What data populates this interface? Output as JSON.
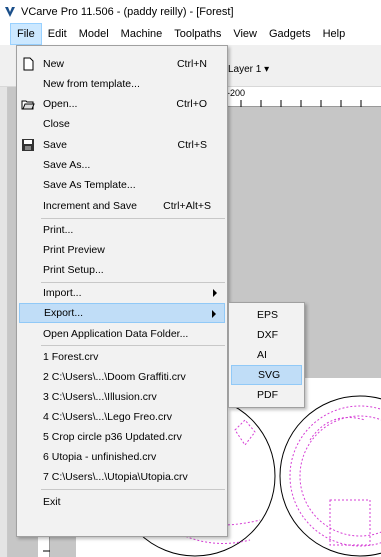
{
  "window": {
    "title": "VCarve Pro 11.506 - (paddy reilly) - [Forest]",
    "accent": "#3c7fb1",
    "highlight": "#c0ddf7"
  },
  "menubar": [
    {
      "label": "File",
      "active": true
    },
    {
      "label": "Edit"
    },
    {
      "label": "Model"
    },
    {
      "label": "Machine"
    },
    {
      "label": "Toolpaths"
    },
    {
      "label": "View"
    },
    {
      "label": "Gadgets"
    },
    {
      "label": "Help"
    }
  ],
  "toolbar": {
    "layer_label": "Layer 1 ▾"
  },
  "ruler": {
    "top_label": "-200"
  },
  "file_menu": {
    "items": [
      {
        "label": "New",
        "shortcut": "Ctrl+N",
        "icon": "new-document-icon"
      },
      {
        "label": "New from template..."
      },
      {
        "label": "Open...",
        "shortcut": "Ctrl+O",
        "icon": "open-folder-icon"
      },
      {
        "label": "Close"
      },
      {
        "label": "Save",
        "shortcut": "Ctrl+S",
        "icon": "floppy-disk-icon"
      },
      {
        "label": "Save As..."
      },
      {
        "label": "Save As Template..."
      },
      {
        "label": "Increment and Save",
        "shortcut": "Ctrl+Alt+S"
      },
      {
        "label": "Print..."
      },
      {
        "label": "Print Preview"
      },
      {
        "label": "Print Setup..."
      },
      {
        "label": "Import..."
      },
      {
        "label": "Export...",
        "highlighted": true
      },
      {
        "label": "Open Application Data Folder..."
      },
      {
        "label": "1 Forest.crv"
      },
      {
        "label": "2 C:\\Users\\...\\Doom Graffiti.crv"
      },
      {
        "label": "3 C:\\Users\\...\\Illusion.crv"
      },
      {
        "label": "4 C:\\Users\\...\\Lego Freo.crv"
      },
      {
        "label": "5 Crop circle p36 Updated.crv"
      },
      {
        "label": "6 Utopia - unfinished.crv"
      },
      {
        "label": "7 C:\\Users\\...\\Utopia\\Utopia.crv"
      },
      {
        "label": "Exit"
      }
    ]
  },
  "export_submenu": {
    "items": [
      {
        "label": "EPS"
      },
      {
        "label": "DXF"
      },
      {
        "label": "AI"
      },
      {
        "label": "SVG",
        "highlighted": true
      },
      {
        "label": "PDF"
      }
    ]
  }
}
